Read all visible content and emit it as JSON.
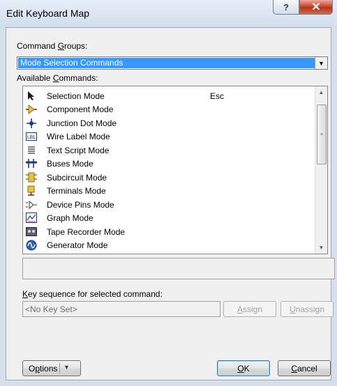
{
  "window": {
    "title": "Edit Keyboard Map",
    "help_glyph": "?",
    "close_glyph": "✕"
  },
  "command_groups": {
    "label_pre": "Command ",
    "label_key": "G",
    "label_post": "roups:",
    "selected": "Mode Selection Commands",
    "dropdown_glyph": "▼"
  },
  "available_commands": {
    "label_pre": "Available ",
    "label_key": "C",
    "label_post": "ommands:",
    "items": [
      {
        "name": "Selection Mode",
        "key": "Esc",
        "icon": "cursor-arrow-icon"
      },
      {
        "name": "Component Mode",
        "key": "",
        "icon": "component-icon"
      },
      {
        "name": "Junction Dot Mode",
        "key": "",
        "icon": "junction-dot-icon"
      },
      {
        "name": "Wire Label Mode",
        "key": "",
        "icon": "wire-label-icon",
        "icon_text": "LBL"
      },
      {
        "name": "Text Script Mode",
        "key": "",
        "icon": "text-script-icon"
      },
      {
        "name": "Buses Mode",
        "key": "",
        "icon": "bus-icon"
      },
      {
        "name": "Subcircuit Mode",
        "key": "",
        "icon": "subcircuit-icon"
      },
      {
        "name": "Terminals Mode",
        "key": "",
        "icon": "terminal-icon"
      },
      {
        "name": "Device Pins Mode",
        "key": "",
        "icon": "device-pin-icon"
      },
      {
        "name": "Graph Mode",
        "key": "",
        "icon": "graph-icon"
      },
      {
        "name": "Tape Recorder Mode",
        "key": "",
        "icon": "tape-recorder-icon"
      },
      {
        "name": "Generator Mode",
        "key": "",
        "icon": "generator-icon"
      }
    ],
    "scroll_up_glyph": "▲",
    "scroll_down_glyph": "▼",
    "thumb_grip": "≡"
  },
  "key_sequence": {
    "label_key": "K",
    "label_post": "ey sequence for selected command:",
    "value": "<No Key Set>"
  },
  "buttons": {
    "assign_key": "A",
    "assign_post": "ssign",
    "unassign_key": "U",
    "unassign_post": "nassign",
    "options_pre": "O",
    "options_key": "p",
    "options_post": "tions",
    "options_arrow": "▼",
    "ok_key": "O",
    "ok_post": "K",
    "cancel_key": "C",
    "cancel_post": "ancel"
  },
  "colors": {
    "selection": "#3399ff",
    "close_button": "#c9412a",
    "window_frame": "#d6dfea"
  }
}
